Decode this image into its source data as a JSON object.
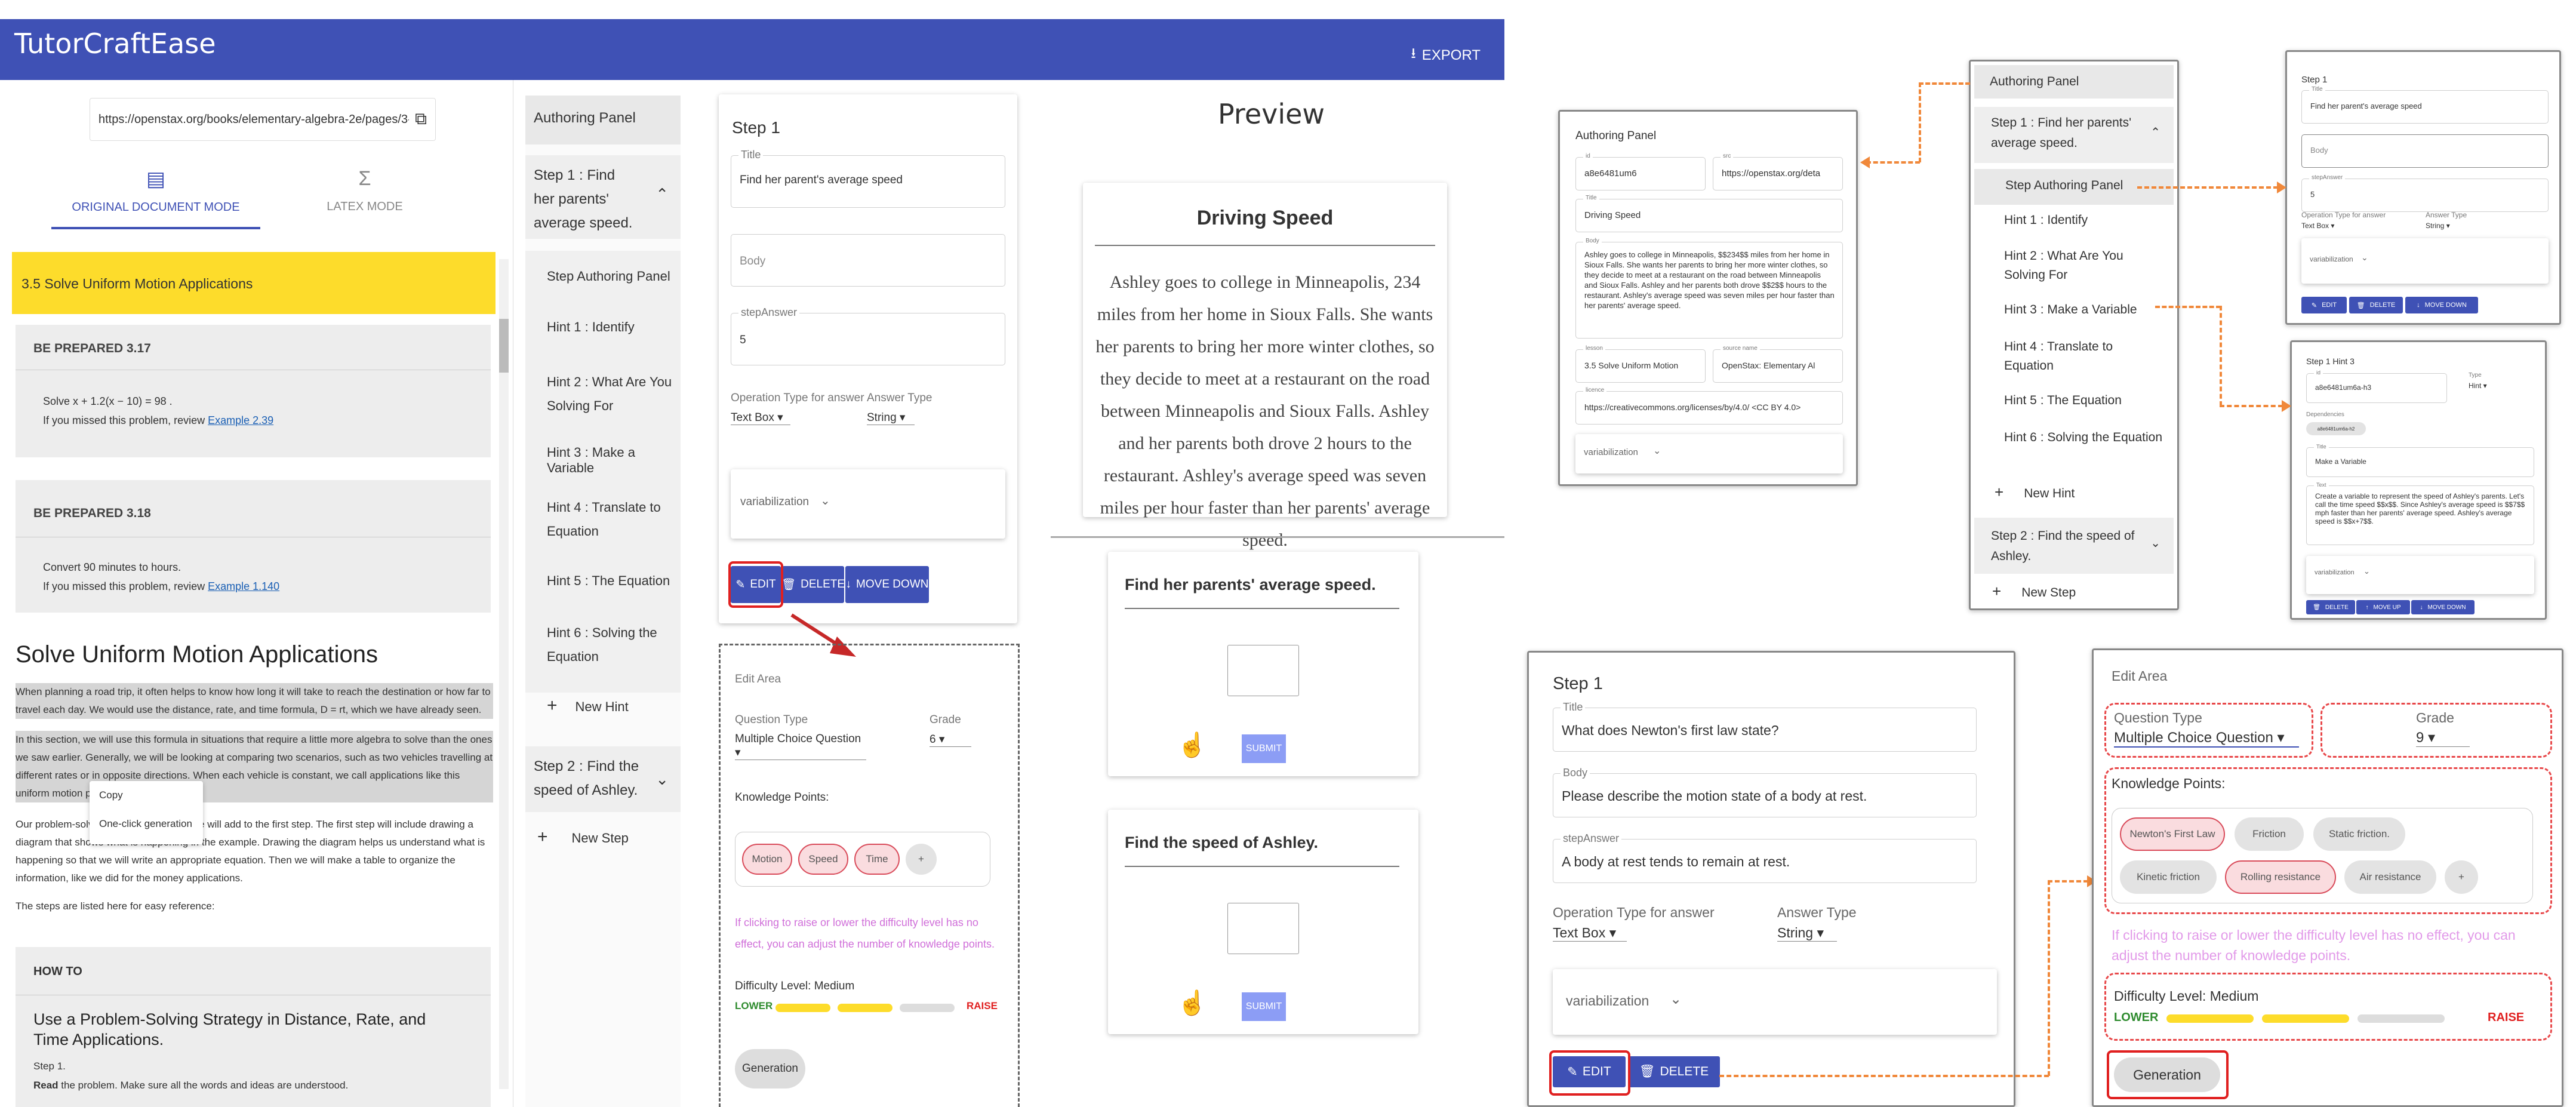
{
  "app": {
    "title": "TutorCraftEase",
    "export": "EXPORT"
  },
  "doc": {
    "url": "https://openstax.org/books/elementary-algebra-2e/pages/3-5-",
    "mode_original": "ORIGINAL DOCUMENT MODE",
    "mode_latex": "LATEX MODE",
    "section_title": "3.5 Solve Uniform Motion Applications",
    "bp1_title": "BE PREPARED 3.17",
    "bp1_line1": "Solve x + 1.2(x − 10) = 98 .",
    "bp1_line2": "If you missed this problem, review ",
    "bp1_link": "Example 2.39",
    "bp2_title": "BE PREPARED 3.18",
    "bp2_line1": "Convert 90 minutes to hours.",
    "bp2_line2": "If you missed this problem, review ",
    "bp2_link": "Example 1.140",
    "heading": "Solve Uniform Motion Applications",
    "p1": "When planning a road trip, it often helps to know how long it will take to reach the destination or how far to travel each day. We would use the distance, rate, and time formula, D = rt, which we have already seen.",
    "p2": "In this section, we will use this formula in situations that require a little more algebra to solve than the ones we saw earlier. Generally, we will be looking at comparing two scenarios, such as two vehicles travelling at different rates or in opposite directions. When each vehicle is constant, we call applications like this uniform motion problems.",
    "p3": "Our problem-solving strategy here, but we will add to the first step. The first step will include drawing a diagram that shows what is happening in the example. Drawing the diagram helps us understand what is happening so that we will write an appropriate equation. Then we will make a table to organize the information, like we did for the money applications.",
    "p4": "The steps are listed here for easy reference:",
    "ctx_copy": "Copy",
    "ctx_gen": "One-click generation",
    "howto": "HOW TO",
    "howto_title": "Use a Problem-Solving Strategy in Distance, Rate, and Time Applications.",
    "step1": "Step 1.",
    "read": "Read",
    "read_rest": " the problem. Make sure all the words and ideas are understood."
  },
  "nav": {
    "header": "Authoring Panel",
    "step1": "Step 1 : Find her parents' average speed.",
    "items": [
      "Step Authoring Panel",
      "Hint 1 : Identify",
      "Hint 2 : What Are You Solving For",
      "Hint 3 : Make a Variable",
      "Hint 4 : Translate to Equation",
      "Hint 5 : The Equation",
      "Hint 6 : Solving the Equation"
    ],
    "new_hint": "New Hint",
    "step2": "Step 2 : Find the speed of Ashley.",
    "new_step": "New Step"
  },
  "editor": {
    "step": "Step 1",
    "title_label": "Title",
    "title_value": "Find her parent's average speed",
    "body_label": "Body",
    "answer_label": "stepAnswer",
    "answer_value": "5",
    "op_label": "Operation Type for answer",
    "op_value": "Text Box",
    "ans_type_label": "Answer Type",
    "ans_type_value": "String",
    "variab": "variabilization",
    "edit": "EDIT",
    "delete": "DELETE",
    "move_down": "MOVE DOWN"
  },
  "editarea": {
    "title": "Edit Area",
    "qtype_label": "Question Type",
    "qtype_value": "Multiple Choice Question",
    "grade_label": "Grade",
    "grade_value": "6",
    "kp_label": "Knowledge Points:",
    "chips": [
      "Motion",
      "Speed",
      "Time"
    ],
    "plus": "+",
    "note": "If clicking to raise or lower the difficulty level has no effect, you can adjust the number of knowledge points.",
    "diff": "Difficulty Level: Medium",
    "lower": "LOWER",
    "raise": "RAISE",
    "generation": "Generation"
  },
  "preview": {
    "title": "Preview",
    "card_title": "Driving Speed",
    "text": "Ashley goes to college in Minneapolis, 234 miles from her home in Sioux Falls. She wants her parents to bring her more winter clothes, so they decide to meet at a restaurant on the road between Minneapolis and Sioux Falls. Ashley and her parents both drove 2 hours to the restaurant. Ashley's average speed was seven miles per hour faster than her parents' average speed.",
    "q1": "Find her parents' average speed.",
    "q2": "Find the speed of Ashley.",
    "submit": "SUBMIT"
  },
  "fig_ap": {
    "title": "Authoring Panel",
    "id_label": "id",
    "id_value": "a8e6481um6",
    "src_label": "src",
    "src_value": "https://openstax.org/deta",
    "title_label": "Title",
    "title_value": "Driving Speed",
    "body_label": "Body",
    "body_value": "Ashley goes to college in Minneapolis, $$234$$ miles from her home in Sioux Falls. She wants her parents to bring her more winter clothes, so they decide to meet at a restaurant on the road between Minneapolis and Sioux Falls. Ashley and her parents both drove $$2$$ hours to the restaurant. Ashley's average speed was seven miles per hour faster than her parents' average speed.",
    "lesson_label": "lesson",
    "lesson_value": "3.5 Solve Uniform Motion",
    "source_label": "source name",
    "source_value": "OpenStax: Elementary Al",
    "licence_label": "licence",
    "licence_value": "https://creativecommons.org/licenses/by/4.0/ <CC BY 4.0>",
    "variab": "variabilization"
  },
  "fig_nav": {
    "header": "Authoring Panel",
    "step1": "Step 1 : Find her parents' average speed.",
    "items": [
      "Step Authoring Panel",
      "Hint 1 : Identify",
      "Hint 2 : What Are You Solving For",
      "Hint 3 : Make a Variable",
      "Hint 4 : Translate to Equation",
      "Hint 5 : The Equation",
      "Hint 6 : Solving the Equation"
    ],
    "new_hint": "New Hint",
    "step2": "Step 2 : Find the speed of Ashley.",
    "new_step": "New Step"
  },
  "fig_step": {
    "step": "Step 1",
    "title_label": "Title",
    "title_value": "Find her parent's average speed",
    "body_label": "Body",
    "answer_label": "stepAnswer",
    "answer_value": "5",
    "op_label": "Operation Type for answer",
    "op_value": "Text Box",
    "type_label": "Answer Type",
    "type_value": "String",
    "variab": "variabilization",
    "edit": "EDIT",
    "delete": "DELETE",
    "move_down": "MOVE DOWN"
  },
  "fig_hint": {
    "title": "Step 1 Hint 3",
    "id_label": "id",
    "id_value": "a8e6481um6a-h3",
    "type_label": "Type",
    "type_value": "Hint",
    "dep_label": "Dependencies",
    "dep_chip": "a8e6481um6a-h2",
    "t_label": "Title",
    "t_value": "Make a Variable",
    "text_label": "Text",
    "text_value": "Create a variable to represent the speed of Ashley's parents. Let's call the time speed $$x$$. Since Ashley's average speed is $$7$$ mph faster than her parents' average speed. Ashley's average speed is $$x+7$$.",
    "variab": "variabilization",
    "delete": "DELETE",
    "move_up": "MOVE UP",
    "move_down": "MOVE DOWN"
  },
  "fig_step2": {
    "step": "Step 1",
    "title_label": "Title",
    "title_value": "What does Newton's first law state?",
    "body_label": "Body",
    "body_value": "Please describe the motion state of a body at rest.",
    "answer_label": "stepAnswer",
    "answer_value": "A body at rest tends to remain at rest.",
    "op_label": "Operation Type for answer",
    "op_value": "Text Box",
    "type_label": "Answer Type",
    "type_value": "String",
    "variab": "variabilization",
    "edit": "EDIT",
    "delete": "DELETE"
  },
  "fig_edit": {
    "title": "Edit Area",
    "qtype_label": "Question Type",
    "qtype_value": "Multiple Choice Question",
    "grade_label": "Grade",
    "grade_value": "9",
    "kp_label": "Knowledge Points:",
    "chips": [
      "Newton's First Law",
      "Friction",
      "Static friction.",
      "Kinetic friction",
      "Rolling resistance",
      "Air resistance"
    ],
    "plus": "+",
    "note": "If clicking to raise or lower the difficulty level has no effect, you can adjust the number of knowledge points.",
    "diff": "Difficulty Level: Medium",
    "lower": "LOWER",
    "raise": "RAISE",
    "generation": "Generation"
  },
  "colors": {
    "primary": "#3f51b5",
    "yellow": "#fddc2b",
    "red": "#e02020",
    "orange": "#f0883a",
    "pink": "#fadcdf",
    "green": "#2e8b2e"
  }
}
